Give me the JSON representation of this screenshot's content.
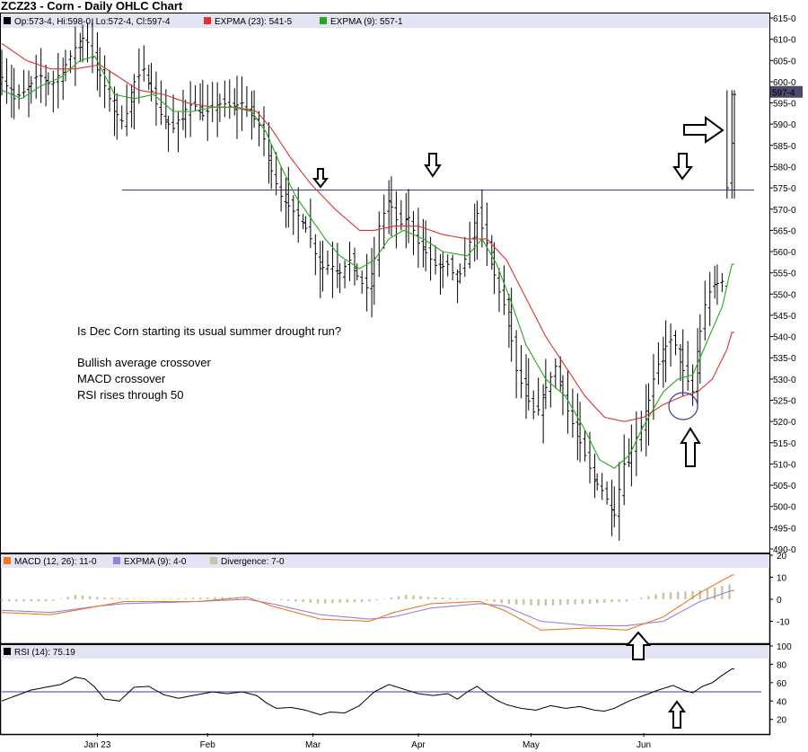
{
  "chart_data": [
    {
      "type": "ohlc",
      "title": "ZCZ23 - Corn - Daily OHLC Chart",
      "legend": [
        {
          "text": "Op:573-4, Hi:598-0, Lo:572-4, Cl:597-4",
          "color": "#000000"
        },
        {
          "text": "EXPMA (23): 541-5",
          "color": "#e03030"
        },
        {
          "text": "EXPMA (9): 557-1",
          "color": "#22aa22"
        }
      ],
      "last_price_label": "597-4",
      "x_labels": [
        "Jan 23",
        "Feb",
        "Mar",
        "Apr",
        "May",
        "Jun"
      ],
      "y_ticks": [
        "615-0",
        "610-0",
        "605-0",
        "600-0",
        "595-0",
        "590-0",
        "585-0",
        "580-0",
        "575-0",
        "570-0",
        "565-0",
        "560-0",
        "555-0",
        "550-0",
        "545-0",
        "540-0",
        "535-0",
        "530-0",
        "525-0",
        "520-0",
        "515-0",
        "510-0",
        "505-0",
        "500-0",
        "495-0",
        "490-0"
      ],
      "ylim": [
        490,
        617
      ],
      "resistance_level": 574.5,
      "colors": {
        "bars": "#000000",
        "ema_slow": "#e03030",
        "ema_fast": "#22aa22",
        "resistance": "#3a3aa0"
      },
      "annotations": [
        "Is  Dec Corn starting its usual summer drought run?",
        "Bullish average crossover",
        "MACD crossover",
        "RSI rises through 50"
      ],
      "close_path": [
        [
          0,
          601
        ],
        [
          5,
          596
        ],
        [
          10,
          598
        ],
        [
          15,
          602
        ],
        [
          20,
          599
        ],
        [
          25,
          603
        ],
        [
          30,
          608
        ],
        [
          34,
          611
        ],
        [
          38,
          604
        ],
        [
          42,
          599
        ],
        [
          46,
          593
        ],
        [
          50,
          590
        ],
        [
          54,
          600
        ],
        [
          58,
          603
        ],
        [
          62,
          596
        ],
        [
          66,
          591
        ],
        [
          70,
          589
        ],
        [
          74,
          593
        ],
        [
          78,
          595
        ],
        [
          82,
          592
        ],
        [
          86,
          594
        ],
        [
          90,
          595
        ],
        [
          94,
          594
        ],
        [
          98,
          595
        ],
        [
          102,
          592
        ],
        [
          106,
          589
        ],
        [
          110,
          579
        ],
        [
          114,
          573
        ],
        [
          118,
          570
        ],
        [
          122,
          568
        ],
        [
          126,
          563
        ],
        [
          130,
          556
        ],
        [
          134,
          557
        ],
        [
          138,
          555
        ],
        [
          142,
          558
        ],
        [
          146,
          553
        ],
        [
          150,
          551
        ],
        [
          154,
          566
        ],
        [
          158,
          572
        ],
        [
          162,
          566
        ],
        [
          166,
          568
        ],
        [
          170,
          562
        ],
        [
          174,
          559
        ],
        [
          178,
          556
        ],
        [
          182,
          557
        ],
        [
          186,
          553
        ],
        [
          190,
          560
        ],
        [
          194,
          569
        ],
        [
          198,
          562
        ],
        [
          202,
          552
        ],
        [
          206,
          546
        ],
        [
          210,
          532
        ],
        [
          214,
          526
        ],
        [
          218,
          521
        ],
        [
          222,
          528
        ],
        [
          226,
          533
        ],
        [
          230,
          524
        ],
        [
          234,
          518
        ],
        [
          238,
          512
        ],
        [
          242,
          506
        ],
        [
          246,
          503
        ],
        [
          250,
          498
        ],
        [
          254,
          510
        ],
        [
          258,
          515
        ],
        [
          262,
          520
        ],
        [
          266,
          530
        ],
        [
          270,
          537
        ],
        [
          274,
          540
        ],
        [
          278,
          532
        ],
        [
          282,
          527
        ],
        [
          286,
          546
        ],
        [
          290,
          552
        ],
        [
          294,
          553
        ],
        [
          298,
          597
        ]
      ],
      "ema_fast_path": [
        [
          0,
          598
        ],
        [
          8,
          596
        ],
        [
          16,
          599
        ],
        [
          24,
          601
        ],
        [
          32,
          605
        ],
        [
          38,
          606
        ],
        [
          46,
          597
        ],
        [
          54,
          596
        ],
        [
          62,
          597
        ],
        [
          70,
          593
        ],
        [
          78,
          593
        ],
        [
          86,
          594
        ],
        [
          94,
          594
        ],
        [
          102,
          593
        ],
        [
          108,
          588
        ],
        [
          114,
          580
        ],
        [
          120,
          573
        ],
        [
          126,
          568
        ],
        [
          132,
          563
        ],
        [
          138,
          559
        ],
        [
          146,
          556
        ],
        [
          152,
          558
        ],
        [
          158,
          563
        ],
        [
          164,
          565
        ],
        [
          172,
          563
        ],
        [
          180,
          560
        ],
        [
          190,
          559
        ],
        [
          196,
          563
        ],
        [
          202,
          557
        ],
        [
          208,
          548
        ],
        [
          214,
          538
        ],
        [
          222,
          530
        ],
        [
          230,
          526
        ],
        [
          238,
          518
        ],
        [
          244,
          511
        ],
        [
          250,
          509
        ],
        [
          256,
          512
        ],
        [
          262,
          519
        ],
        [
          270,
          527
        ],
        [
          276,
          530
        ],
        [
          282,
          531
        ],
        [
          288,
          539
        ],
        [
          294,
          547
        ],
        [
          298,
          557
        ]
      ],
      "ema_slow_path": [
        [
          0,
          609
        ],
        [
          10,
          605
        ],
        [
          20,
          603
        ],
        [
          30,
          603
        ],
        [
          40,
          604
        ],
        [
          48,
          601
        ],
        [
          56,
          598
        ],
        [
          66,
          597
        ],
        [
          76,
          595
        ],
        [
          86,
          594
        ],
        [
          96,
          594
        ],
        [
          104,
          593
        ],
        [
          110,
          589
        ],
        [
          118,
          582
        ],
        [
          126,
          576
        ],
        [
          136,
          570
        ],
        [
          146,
          565
        ],
        [
          152,
          565
        ],
        [
          160,
          566
        ],
        [
          170,
          566
        ],
        [
          180,
          564
        ],
        [
          190,
          563
        ],
        [
          198,
          563
        ],
        [
          206,
          558
        ],
        [
          214,
          549
        ],
        [
          222,
          540
        ],
        [
          230,
          533
        ],
        [
          238,
          526
        ],
        [
          246,
          521
        ],
        [
          254,
          520
        ],
        [
          262,
          521
        ],
        [
          270,
          524
        ],
        [
          278,
          526
        ],
        [
          284,
          527
        ],
        [
          290,
          530
        ],
        [
          296,
          537
        ],
        [
          298,
          541
        ]
      ]
    },
    {
      "type": "line",
      "legend": [
        {
          "text": "MACD (12, 26): 11-0",
          "color": "#ee7722"
        },
        {
          "text": "EXPMA (9): 4-0",
          "color": "#9a7fd8"
        },
        {
          "text": "Divergence: 7-0",
          "color": "#c8c4a0"
        }
      ],
      "y_ticks": [
        20,
        10,
        0,
        -10
      ],
      "ylim": [
        -20,
        20
      ],
      "colors": {
        "macd": "#ee7722",
        "signal": "#9a7fd8",
        "divergence": "#c8c4a0"
      },
      "macd_path": [
        [
          0,
          -6
        ],
        [
          20,
          -7
        ],
        [
          40,
          -3
        ],
        [
          50,
          -1
        ],
        [
          80,
          -1
        ],
        [
          100,
          1
        ],
        [
          110,
          -3
        ],
        [
          130,
          -9
        ],
        [
          150,
          -10
        ],
        [
          160,
          -6
        ],
        [
          175,
          -2
        ],
        [
          195,
          -1
        ],
        [
          205,
          -5
        ],
        [
          220,
          -14
        ],
        [
          240,
          -13
        ],
        [
          255,
          -14
        ],
        [
          270,
          -8
        ],
        [
          285,
          3
        ],
        [
          298,
          11
        ]
      ],
      "signal_path": [
        [
          0,
          -5
        ],
        [
          20,
          -6
        ],
        [
          40,
          -3
        ],
        [
          50,
          -2
        ],
        [
          80,
          -1
        ],
        [
          100,
          0
        ],
        [
          110,
          -2
        ],
        [
          130,
          -7
        ],
        [
          150,
          -9
        ],
        [
          160,
          -8
        ],
        [
          175,
          -4
        ],
        [
          195,
          -2
        ],
        [
          205,
          -3
        ],
        [
          220,
          -10
        ],
        [
          240,
          -12
        ],
        [
          255,
          -12
        ],
        [
          270,
          -10
        ],
        [
          285,
          -1
        ],
        [
          298,
          4
        ]
      ],
      "divergence_path": [
        [
          0,
          -1
        ],
        [
          20,
          -1
        ],
        [
          30,
          2
        ],
        [
          40,
          1
        ],
        [
          60,
          0
        ],
        [
          90,
          1
        ],
        [
          110,
          0
        ],
        [
          130,
          -2
        ],
        [
          150,
          -1
        ],
        [
          165,
          2
        ],
        [
          175,
          1
        ],
        [
          195,
          0
        ],
        [
          205,
          -2
        ],
        [
          220,
          -3
        ],
        [
          240,
          -2
        ],
        [
          255,
          -1
        ],
        [
          270,
          3
        ],
        [
          285,
          4
        ],
        [
          298,
          7
        ]
      ]
    },
    {
      "type": "line",
      "legend": [
        {
          "text": "RSI (14): 75.19",
          "color": "#000000"
        }
      ],
      "y_ticks": [
        100,
        80,
        60,
        40,
        20
      ],
      "ylim": [
        4,
        100
      ],
      "reference_level": 50,
      "colors": {
        "rsi": "#000000",
        "reference": "#3a3aa0"
      },
      "rsi_path": [
        [
          0,
          40
        ],
        [
          6,
          46
        ],
        [
          12,
          52
        ],
        [
          18,
          55
        ],
        [
          24,
          58
        ],
        [
          30,
          66
        ],
        [
          34,
          64
        ],
        [
          38,
          55
        ],
        [
          42,
          42
        ],
        [
          48,
          40
        ],
        [
          54,
          55
        ],
        [
          60,
          56
        ],
        [
          66,
          47
        ],
        [
          72,
          43
        ],
        [
          80,
          47
        ],
        [
          86,
          50
        ],
        [
          92,
          48
        ],
        [
          98,
          50
        ],
        [
          104,
          46
        ],
        [
          108,
          38
        ],
        [
          112,
          32
        ],
        [
          118,
          33
        ],
        [
          124,
          30
        ],
        [
          130,
          25
        ],
        [
          134,
          28
        ],
        [
          140,
          27
        ],
        [
          146,
          35
        ],
        [
          152,
          50
        ],
        [
          158,
          58
        ],
        [
          164,
          53
        ],
        [
          170,
          48
        ],
        [
          176,
          46
        ],
        [
          182,
          48
        ],
        [
          186,
          42
        ],
        [
          190,
          50
        ],
        [
          194,
          56
        ],
        [
          198,
          48
        ],
        [
          202,
          41
        ],
        [
          206,
          36
        ],
        [
          212,
          32
        ],
        [
          218,
          30
        ],
        [
          224,
          35
        ],
        [
          230,
          32
        ],
        [
          236,
          34
        ],
        [
          242,
          30
        ],
        [
          246,
          29
        ],
        [
          250,
          32
        ],
        [
          256,
          40
        ],
        [
          262,
          46
        ],
        [
          268,
          52
        ],
        [
          274,
          57
        ],
        [
          278,
          52
        ],
        [
          282,
          49
        ],
        [
          286,
          56
        ],
        [
          290,
          60
        ],
        [
          294,
          68
        ],
        [
          298,
          75
        ]
      ]
    }
  ]
}
